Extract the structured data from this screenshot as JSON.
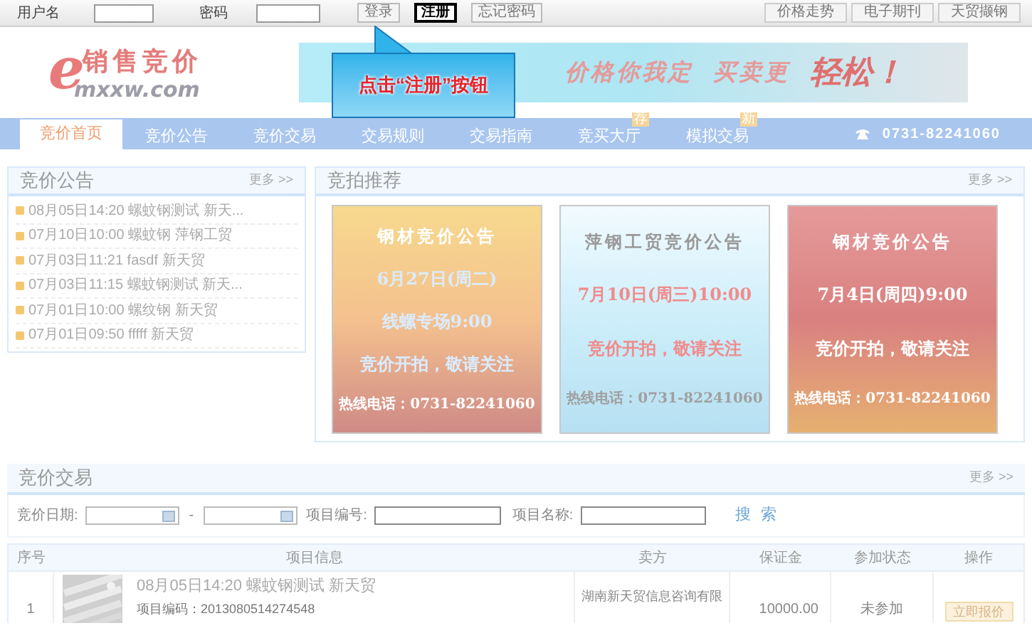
{
  "top_bar": {
    "username_label": "用户名",
    "password_label": "密码",
    "buttons": [
      {
        "label": "登录",
        "highlighted": false
      },
      {
        "label": "注册",
        "highlighted": true
      },
      {
        "label": "忘记密码",
        "highlighted": false
      }
    ],
    "links": [
      "价格走势",
      "电子期刊",
      "天贸撷钢"
    ]
  },
  "logo": {
    "mark": "e",
    "title": "销售竞价",
    "domain": "mxxw.com"
  },
  "banner": {
    "slogan": "价格你我定",
    "slogan_2": "买卖更",
    "emphasis": "轻松！"
  },
  "callout": {
    "text": "点击“注册”按钮"
  },
  "nav": {
    "tabs": [
      {
        "label": "竞价首页",
        "selected": true
      },
      {
        "label": "竞价公告",
        "selected": false
      },
      {
        "label": "竞价交易",
        "selected": false
      },
      {
        "label": "交易规则",
        "selected": false
      },
      {
        "label": "交易指南",
        "selected": false
      },
      {
        "label": "竞买大厅",
        "selected": false,
        "badge": "荐"
      },
      {
        "label": "模拟交易",
        "selected": false,
        "badge": "新"
      }
    ],
    "phone": "0731-82241060"
  },
  "announcements": {
    "title": "竞价公告",
    "more": "更多 >>",
    "items": [
      {
        "time": "08月05日14:20",
        "text": "螺蚊钢测试 新天..."
      },
      {
        "time": "07月10日10:00",
        "text": "螺蚊钢 萍钢工贸"
      },
      {
        "time": "07月03日11:21",
        "text": "fasdf 新天贸"
      },
      {
        "time": "07月03日11:15",
        "text": "螺蚊钢测试 新天..."
      },
      {
        "time": "07月01日10:00",
        "text": "螺纹钢 新天贸"
      },
      {
        "time": "07月01日09:50",
        "text": "fffff 新天贸"
      }
    ]
  },
  "recommended": {
    "title": "竞拍推荐",
    "more": "更多 >>",
    "posters": [
      {
        "kind": "sunrise",
        "lines": [
          "钢材竞价公告",
          "6月27日(周二)",
          "线螺专场9:00",
          "竞价开拍，敬请关注",
          "热线电话：0731-82241060"
        ]
      },
      {
        "kind": "sky",
        "lines": [
          "萍钢工贸竞价公告",
          "7月10日(周三)10:00",
          "竞价开拍，敬请关注",
          "热线电话：0731-82241060"
        ]
      },
      {
        "kind": "stage",
        "lines": [
          "钢材竞价公告",
          "7月4日(周四)9:00",
          "竞价开拍，敬请关注",
          "热线电话：0731-82241060"
        ]
      }
    ]
  },
  "trading": {
    "title": "竞价交易",
    "more": "更多 >>",
    "search": {
      "date_label": "竞价日期:",
      "dash": "-",
      "code_label": "项目编号:",
      "name_label": "项目名称:",
      "button": "搜 索"
    },
    "table": {
      "columns": [
        "序号",
        "项目信息",
        "卖方",
        "保证金",
        "参加状态",
        "操作"
      ],
      "rows": [
        {
          "index": "1",
          "title": "08月05日14:20 螺蚊钢测试 新天贸",
          "code": "项目编码：2013080514274548",
          "seller": "湖南新天贸信息咨询有限",
          "deposit": "10000.00",
          "status": "未参加",
          "action": "立即报价"
        }
      ]
    }
  }
}
